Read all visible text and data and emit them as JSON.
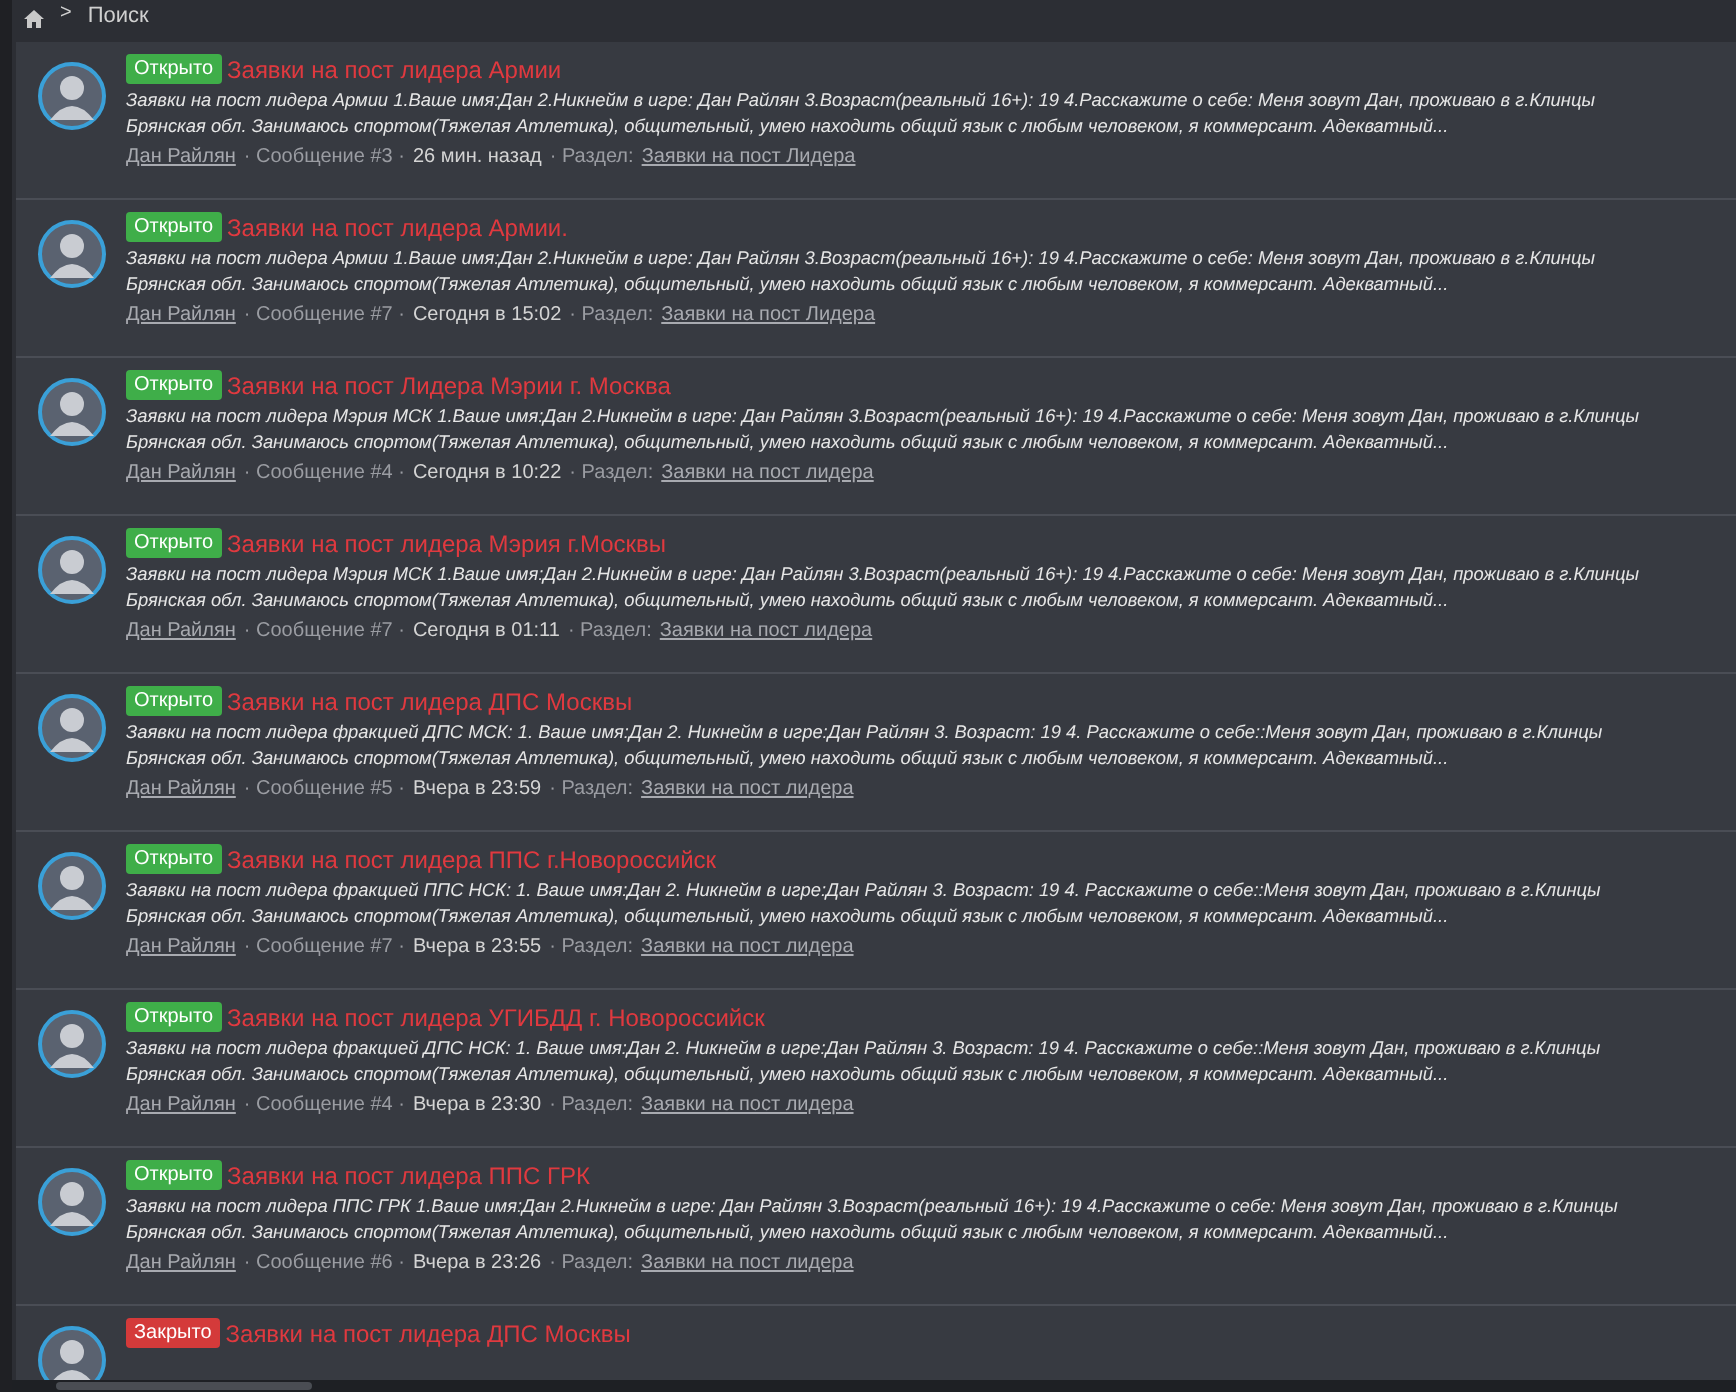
{
  "breadcrumb": {
    "separator": ">",
    "current": "Поиск"
  },
  "results": [
    {
      "status": {
        "kind": "open",
        "label": "Открыто"
      },
      "title": "Заявки на пост лидера Армии",
      "snippet": "Заявки на пост лидера Армии 1.Ваше имя:Дан 2.Никнейм в игре: Дан Райлян 3.Возраст(реальный 16+): 19 4.Расскажите о себе: Меня зовут Дан, проживаю в г.Клинцы Брянская обл. Занимаюсь спортом(Тяжелая Атлетика), общительный, умею находить общий язык с любым человеком, я коммерсант. Адекватный...",
      "author": "Дан Райлян",
      "message": "· Сообщение #3 ·",
      "time": "26 мин. назад",
      "section_label": "· Раздел:",
      "section": "Заявки на пост Лидера"
    },
    {
      "status": {
        "kind": "open",
        "label": "Открыто"
      },
      "title": "Заявки на пост лидера Армии.",
      "snippet": "Заявки на пост лидера Армии 1.Ваше имя:Дан 2.Никнейм в игре: Дан Райлян 3.Возраст(реальный 16+): 19 4.Расскажите о себе: Меня зовут Дан, проживаю в г.Клинцы Брянская обл. Занимаюсь спортом(Тяжелая Атлетика), общительный, умею находить общий язык с любым человеком, я коммерсант. Адекватный...",
      "author": "Дан Райлян",
      "message": "· Сообщение #7 ·",
      "time": "Сегодня в 15:02",
      "section_label": "· Раздел:",
      "section": "Заявки на пост Лидера"
    },
    {
      "status": {
        "kind": "open",
        "label": "Открыто"
      },
      "title": "Заявки на пост Лидера Мэрии г. Москва",
      "snippet": "Заявки на пост лидера Мэрия МСК 1.Ваше имя:Дан 2.Никнейм в игре: Дан Райлян 3.Возраст(реальный 16+): 19 4.Расскажите о себе: Меня зовут Дан, проживаю в г.Клинцы Брянская обл. Занимаюсь спортом(Тяжелая Атлетика), общительный, умею находить общий язык с любым человеком, я коммерсант. Адекватный...",
      "author": "Дан Райлян",
      "message": "· Сообщение #4 ·",
      "time": "Сегодня в 10:22",
      "section_label": "· Раздел:",
      "section": "Заявки на пост лидера"
    },
    {
      "status": {
        "kind": "open",
        "label": "Открыто"
      },
      "title": "Заявки на пост лидера Мэрия г.Москвы",
      "snippet": "Заявки на пост лидера Мэрия МСК 1.Ваше имя:Дан 2.Никнейм в игре: Дан Райлян 3.Возраст(реальный 16+): 19 4.Расскажите о себе: Меня зовут Дан, проживаю в г.Клинцы Брянская обл. Занимаюсь спортом(Тяжелая Атлетика), общительный, умею находить общий язык с любым человеком, я коммерсант. Адекватный...",
      "author": "Дан Райлян",
      "message": "· Сообщение #7 ·",
      "time": "Сегодня в 01:11",
      "section_label": "· Раздел:",
      "section": "Заявки на пост лидера"
    },
    {
      "status": {
        "kind": "open",
        "label": "Открыто"
      },
      "title": "Заявки на пост лидера ДПС Москвы",
      "snippet": "Заявки на пост лидера фракцией ДПС МСК: 1. Ваше имя:Дан 2. Никнейм в игре:Дан Райлян 3. Возраст: 19 4. Расскажите о себе::Меня зовут Дан, проживаю в г.Клинцы Брянская обл. Занимаюсь спортом(Тяжелая Атлетика), общительный, умею находить общий язык с любым человеком, я коммерсант. Адекватный...",
      "author": "Дан Райлян",
      "message": "· Сообщение #5 ·",
      "time": "Вчера в 23:59",
      "section_label": "· Раздел:",
      "section": "Заявки на пост лидера"
    },
    {
      "status": {
        "kind": "open",
        "label": "Открыто"
      },
      "title": "Заявки на пост лидера ППС г.Новороссийск",
      "snippet": "Заявки на пост лидера фракцией ППС НСК: 1. Ваше имя:Дан 2. Никнейм в игре:Дан Райлян 3. Возраст: 19 4. Расскажите о себе::Меня зовут Дан, проживаю в г.Клинцы Брянская обл. Занимаюсь спортом(Тяжелая Атлетика), общительный, умею находить общий язык с любым человеком, я коммерсант. Адекватный...",
      "author": "Дан Райлян",
      "message": "· Сообщение #7 ·",
      "time": "Вчера в 23:55",
      "section_label": "· Раздел:",
      "section": "Заявки на пост лидера"
    },
    {
      "status": {
        "kind": "open",
        "label": "Открыто"
      },
      "title": "Заявки на пост лидера УГИБДД г. Новороссийск",
      "snippet": "Заявки на пост лидера фракцией ДПС НСК: 1. Ваше имя:Дан 2. Никнейм в игре:Дан Райлян 3. Возраст: 19 4. Расскажите о себе::Меня зовут Дан, проживаю в г.Клинцы Брянская обл. Занимаюсь спортом(Тяжелая Атлетика), общительный, умею находить общий язык с любым человеком, я коммерсант. Адекватный...",
      "author": "Дан Райлян",
      "message": "· Сообщение #4 ·",
      "time": "Вчера в 23:30",
      "section_label": "· Раздел:",
      "section": "Заявки на пост лидера"
    },
    {
      "status": {
        "kind": "open",
        "label": "Открыто"
      },
      "title": "Заявки на пост лидера ППС ГРК",
      "snippet": "Заявки на пост лидера ППС ГРК 1.Ваше имя:Дан 2.Никнейм в игре: Дан Райлян 3.Возраст(реальный 16+): 19 4.Расскажите о себе: Меня зовут Дан, проживаю в г.Клинцы Брянская обл. Занимаюсь спортом(Тяжелая Атлетика), общительный, умею находить общий язык с любым человеком, я коммерсант. Адекватный...",
      "author": "Дан Райлян",
      "message": "· Сообщение #6 ·",
      "time": "Вчера в 23:26",
      "section_label": "· Раздел:",
      "section": "Заявки на пост лидера"
    },
    {
      "status": {
        "kind": "closed",
        "label": "Закрыто"
      },
      "title": "Заявки на пост лидера ДПС Москвы"
    }
  ]
}
